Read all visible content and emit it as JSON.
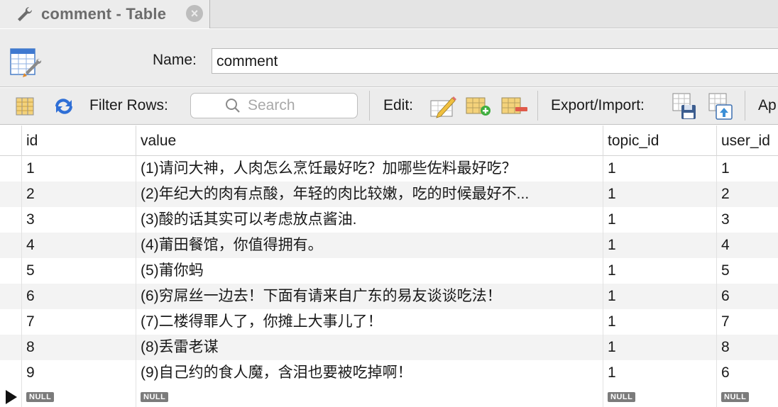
{
  "tab": {
    "title": "comment - Table",
    "close_glyph": "×"
  },
  "name_row": {
    "label": "Name:",
    "value": "comment"
  },
  "toolbar": {
    "filter_label": "Filter Rows:",
    "search_placeholder": "Search",
    "edit_label": "Edit:",
    "export_label": "Export/Import:",
    "overflow_label": "Ap"
  },
  "grid": {
    "columns": [
      "id",
      "value",
      "topic_id",
      "user_id"
    ],
    "rows": [
      [
        "1",
        "(1)请问大神，人肉怎么烹饪最好吃？加哪些佐料最好吃？",
        "1",
        "1"
      ],
      [
        "2",
        "(2)年纪大的肉有点酸，年轻的肉比较嫩，吃的时候最好不...",
        "1",
        "2"
      ],
      [
        "3",
        "(3)酸的话其实可以考虑放点酱油.",
        "1",
        "3"
      ],
      [
        "4",
        "(4)莆田餐馆，你值得拥有。",
        "1",
        "4"
      ],
      [
        "5",
        "(5)莆你蚂",
        "1",
        "5"
      ],
      [
        "6",
        "(6)穷屌丝一边去！下面有请来自广东的易友谈谈吃法！",
        "1",
        "6"
      ],
      [
        "7",
        "(7)二楼得罪人了，你摊上大事儿了！",
        "1",
        "7"
      ],
      [
        "8",
        "(8)丢雷老谋",
        "1",
        "8"
      ],
      [
        "9",
        "(9)自己约的食人魔，含泪也要被吃掉啊！",
        "1",
        "6"
      ]
    ],
    "new_row": [
      "NULL",
      "NULL",
      "NULL",
      "NULL"
    ]
  },
  "icons": {
    "tab": "wrench-icon",
    "table": "table-edit-icon",
    "columns_toggle": "columns-icon",
    "refresh": "refresh-icon",
    "search": "search-icon",
    "edit_cell": "pencil-edit-icon",
    "add_row": "add-row-icon",
    "delete_row": "delete-row-icon",
    "export": "export-icon",
    "import": "import-icon"
  },
  "colors": {
    "accent_blue": "#2f6fd6",
    "null_badge": "#7b7b7b",
    "alt_row": "#f3f3f3"
  }
}
